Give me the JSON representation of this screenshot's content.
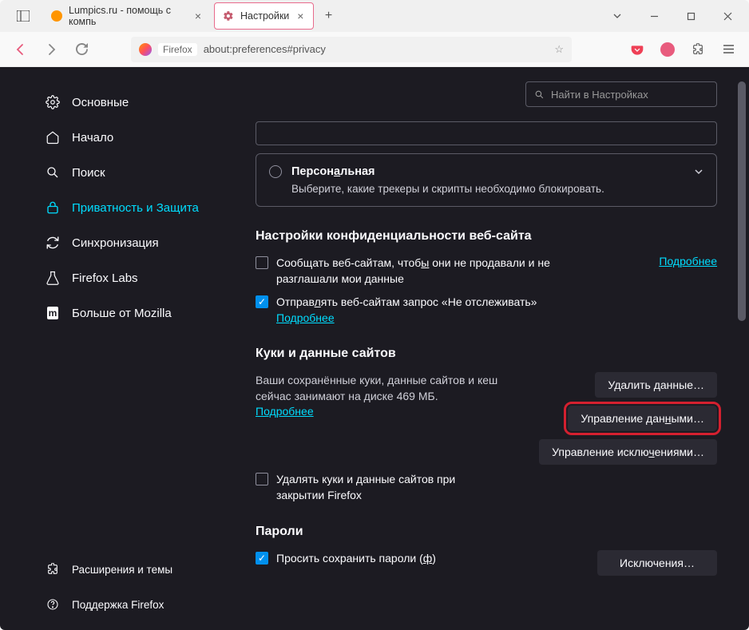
{
  "tabs": {
    "t1": "Lumpics.ru - помощь с компь",
    "t2": "Настройки"
  },
  "url": {
    "prefix": "Firefox",
    "path": "about:preferences#privacy"
  },
  "search": {
    "placeholder": "Найти в Настройках"
  },
  "nav": {
    "general": "Основные",
    "home": "Начало",
    "search": "Поиск",
    "privacy": "Приватность и Защита",
    "sync": "Синхронизация",
    "labs": "Firefox Labs",
    "more": "Больше от Mozilla",
    "ext": "Расширения и темы",
    "support": "Поддержка Firefox"
  },
  "custom": {
    "title": "Персональная",
    "desc": "Выберите, какие трекеры и скрипты необходимо блокировать."
  },
  "wsp": {
    "heading": "Настройки конфиденциальности веб-сайта",
    "opt1": "Сообщать веб-сайтам, чтобы они не продавали и не разглашали мои данные",
    "opt2": "Отправлять веб-сайтам запрос «Не отслеживать»",
    "more": "Подробнее"
  },
  "cookies": {
    "heading": "Куки и данные сайтов",
    "desc": "Ваши сохранённые куки, данные сайтов и кеш сейчас занимают на диске 469 МБ.",
    "more": "Подробнее",
    "delete_on_close": "Удалять куки и данные сайтов при закрытии Firefox",
    "btn_clear": "Удалить данные…",
    "btn_manage": "Управление данными…",
    "btn_exceptions": "Управление исключениями…"
  },
  "passwords": {
    "heading": "Пароли",
    "opt": "Просить сохранить пароли (ф)",
    "btn_exceptions": "Исключения…"
  }
}
